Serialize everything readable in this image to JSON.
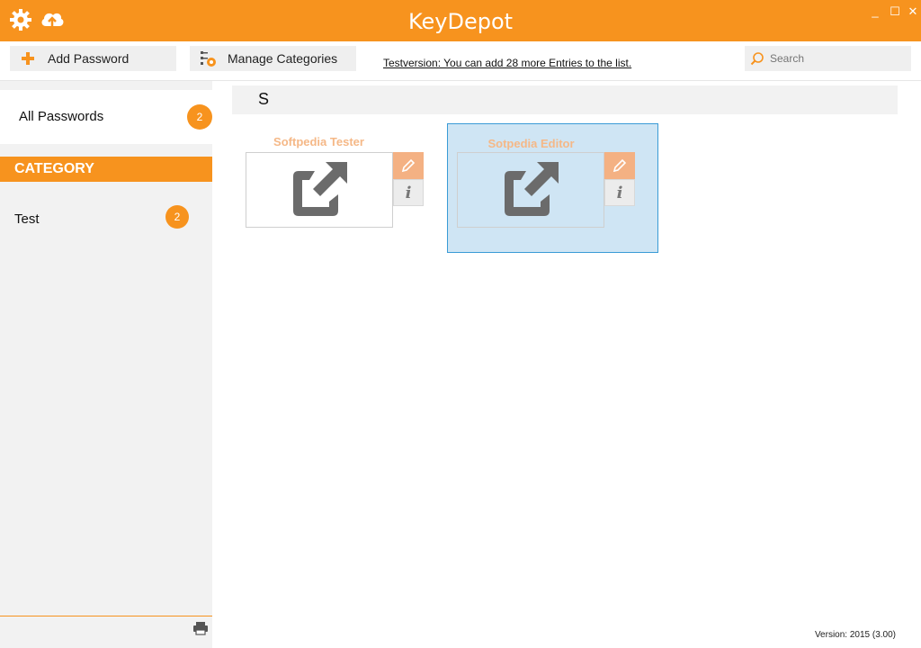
{
  "window": {
    "title": "KeyDepot"
  },
  "toolbar": {
    "add_password_label": "Add Password",
    "manage_categories_label": "Manage Categories",
    "notice": "Testversion: You can add 28 more Entries to the list.",
    "search_placeholder": "Search"
  },
  "sidebar": {
    "all_passwords": {
      "label": "All Passwords",
      "count": "2"
    },
    "category_header": "CATEGORY",
    "categories": [
      {
        "label": "Test",
        "count": "2"
      }
    ]
  },
  "main": {
    "group_letter": "S",
    "entries": [
      {
        "title": "Softpedia Tester",
        "selected": false
      },
      {
        "title": "Sotpedia Editor",
        "selected": true
      }
    ]
  },
  "footer": {
    "version": "Version:  2015 (3.00)"
  },
  "colors": {
    "accent": "#f7931e",
    "selection_bg": "#cfe5f4",
    "selection_border": "#3a9bd6"
  }
}
